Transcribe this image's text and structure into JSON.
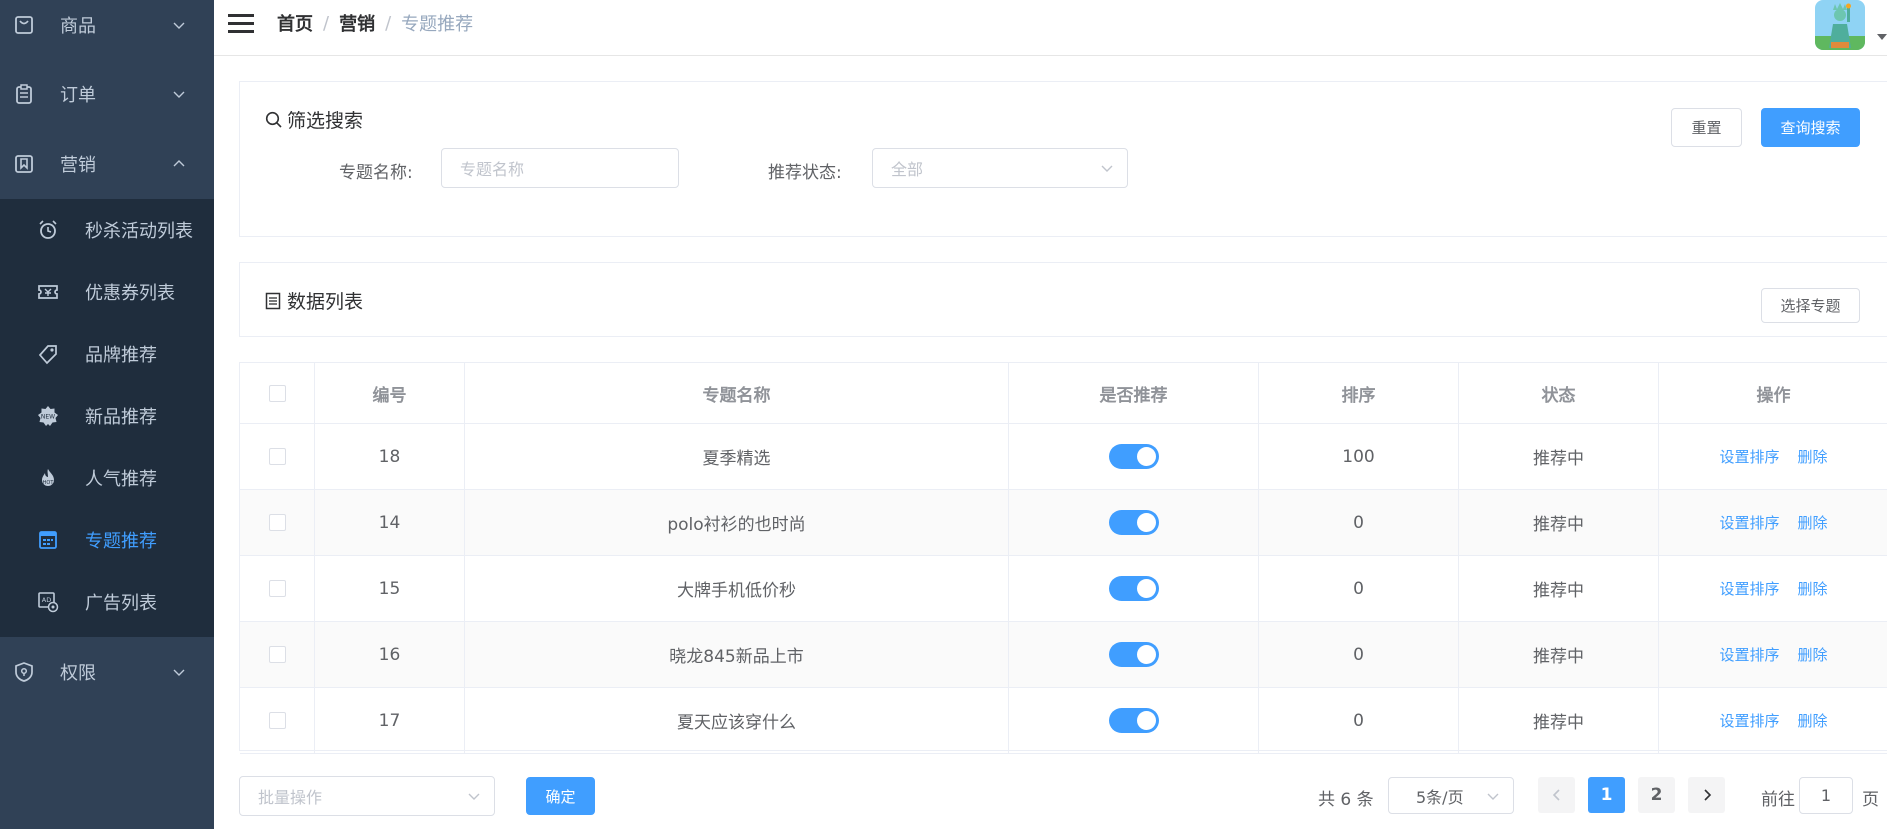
{
  "sidebar": {
    "menu": [
      {
        "label": "商品",
        "icon": "shopping-bag-icon"
      },
      {
        "label": "订单",
        "icon": "clipboard-icon"
      },
      {
        "label": "营销",
        "icon": "bookmark-icon"
      },
      {
        "label": "权限",
        "icon": "shield-icon"
      }
    ],
    "submenu": [
      {
        "label": "秒杀活动列表",
        "icon": "alarm-clock-icon"
      },
      {
        "label": "优惠券列表",
        "icon": "coupon-icon"
      },
      {
        "label": "品牌推荐",
        "icon": "tag-icon"
      },
      {
        "label": "新品推荐",
        "icon": "new-badge-icon"
      },
      {
        "label": "人气推荐",
        "icon": "hot-flame-icon"
      },
      {
        "label": "专题推荐",
        "icon": "calendar-grid-icon",
        "active": true
      },
      {
        "label": "广告列表",
        "icon": "ad-icon"
      }
    ]
  },
  "navbar": {
    "breadcrumb": [
      "首页",
      "营销",
      "专题推荐"
    ],
    "separator": "/"
  },
  "filter": {
    "title": "筛选搜索",
    "reset_label": "重置",
    "search_label": "查询搜索",
    "name_label": "专题名称:",
    "name_placeholder": "专题名称",
    "status_label": "推荐状态:",
    "status_value": "全部"
  },
  "list": {
    "title": "数据列表",
    "select_button": "选择专题"
  },
  "table": {
    "columns": [
      "编号",
      "专题名称",
      "是否推荐",
      "排序",
      "状态",
      "操作"
    ],
    "rows": [
      {
        "id": "18",
        "name": "夏季精选",
        "recommend": true,
        "sort": "100",
        "status": "推荐中"
      },
      {
        "id": "14",
        "name": "polo衬衫的也时尚",
        "recommend": true,
        "sort": "0",
        "status": "推荐中"
      },
      {
        "id": "15",
        "name": "大牌手机低价秒",
        "recommend": true,
        "sort": "0",
        "status": "推荐中"
      },
      {
        "id": "16",
        "name": "晓龙845新品上市",
        "recommend": true,
        "sort": "0",
        "status": "推荐中"
      },
      {
        "id": "17",
        "name": "夏天应该穿什么",
        "recommend": true,
        "sort": "0",
        "status": "推荐中"
      }
    ],
    "action_sort": "设置排序",
    "action_delete": "删除"
  },
  "bottom": {
    "batch_placeholder": "批量操作",
    "confirm_label": "确定",
    "total": "共 6 条",
    "page_size": "5条/页",
    "pages": [
      "1",
      "2"
    ],
    "current_page": "1",
    "goto_prefix": "前往",
    "goto_value": "1",
    "goto_suffix": "页"
  },
  "colors": {
    "sidebar_bg": "#304156",
    "submenu_bg": "#1f2d3d",
    "accent": "#409eff"
  }
}
